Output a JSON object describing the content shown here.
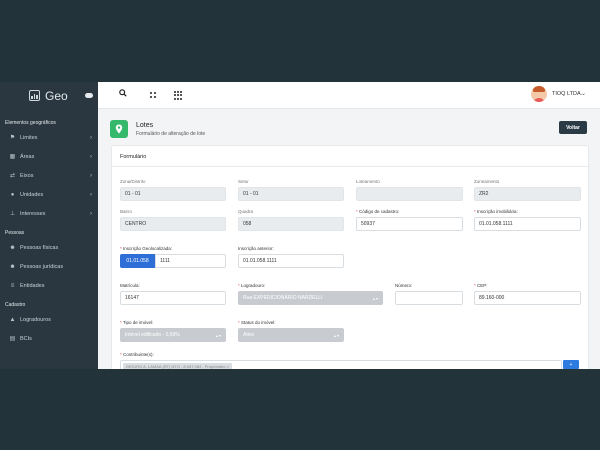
{
  "sidebar": {
    "app_name": "Geo",
    "sections": [
      {
        "title": "Elementos geográficos",
        "items": [
          {
            "label": "Limites",
            "icon": "flag-icon"
          },
          {
            "label": "Áreas",
            "icon": "map-icon"
          },
          {
            "label": "Eixos",
            "icon": "exchange-icon"
          },
          {
            "label": "Unidades",
            "icon": "location-pin-icon"
          },
          {
            "label": "Interesses",
            "icon": "pushpin-icon"
          }
        ]
      },
      {
        "title": "Pessoas",
        "items": [
          {
            "label": "Pessoas físicas",
            "icon": "users-icon"
          },
          {
            "label": "Pessoas jurídicas",
            "icon": "user-group-icon"
          },
          {
            "label": "Entidades",
            "icon": "list-icon"
          }
        ]
      },
      {
        "title": "Cadastro",
        "items": [
          {
            "label": "Logradouros",
            "icon": "road-icon"
          },
          {
            "label": "BCIs",
            "icon": "document-icon"
          }
        ]
      }
    ]
  },
  "topbar": {
    "company": "TIOQ LTDA."
  },
  "page": {
    "title": "Lotes",
    "subtitle": "Formulário de alteração de lote",
    "back_button": "Voltar"
  },
  "form": {
    "title": "Formulário",
    "zona_distrito": {
      "label": "Zona/Distrito",
      "value": "01 - 01"
    },
    "setor": {
      "label": "Setor",
      "value": "01 - 01"
    },
    "loteamento": {
      "label": "Loteamento",
      "value": ""
    },
    "zoneamento": {
      "label": "Zoneamento",
      "value": "ZR2"
    },
    "bairro": {
      "label": "Bairro",
      "value": "CENTRO"
    },
    "quadra": {
      "label": "Quadra",
      "value": "058"
    },
    "codigo_cadastro": {
      "label": "Código de cadastro:",
      "value": "50937"
    },
    "inscricao_imobiliaria": {
      "label": "Inscrição imobiliária:",
      "value": "01.01.058.1111"
    },
    "inscricao_geo": {
      "label": "Inscrição Geolocalizada:",
      "prefix": "01.01.058",
      "value": "1111"
    },
    "inscricao_anterior": {
      "label": "Inscrição anterior:",
      "value": "01.01.058.1111"
    },
    "matricula": {
      "label": "Matrícula:",
      "value": "16147"
    },
    "logradouro": {
      "label": "Logradouro:",
      "value": "Rua EXPEDICIONÁRIO NARDELLI"
    },
    "numero": {
      "label": "Número:",
      "value": ""
    },
    "cep": {
      "label": "CEP:",
      "value": "89.160-000"
    },
    "tipo_imovel": {
      "label": "Tipo de imóvel:",
      "value": "Imóvel edificado - 0,59%"
    },
    "status_imovel": {
      "label": "Status do imóvel:",
      "value": "Ativo"
    },
    "contribuintes": {
      "label": "Contribuinte(s):",
      "value": "DESJRO A. LAMAA (RT) NTO - 8.087.084 - Proprietário"
    },
    "select_arrows": "▴ ▾",
    "remove": "×",
    "add": "+"
  }
}
